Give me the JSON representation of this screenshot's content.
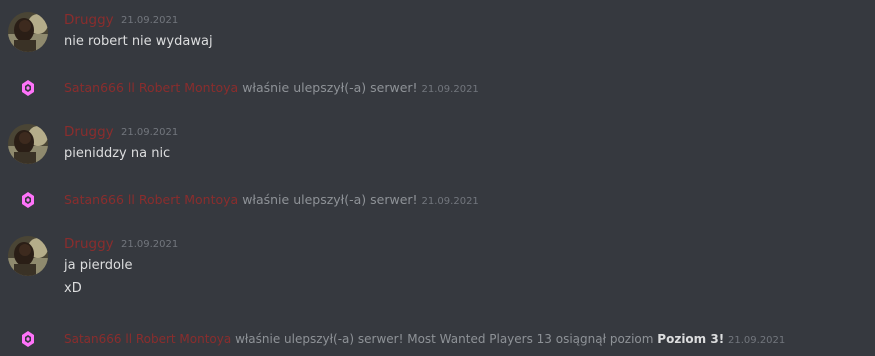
{
  "colors": {
    "background": "#36393f",
    "author_name": "#8a2d2d",
    "message_text": "#dcddde",
    "muted_text": "#8e9297",
    "timestamp": "#72767d",
    "boost_pink": "#ff73fa"
  },
  "messages": [
    {
      "author": "Druggy",
      "timestamp": "21.09.2021",
      "lines": [
        "nie robert nie wydawaj"
      ]
    },
    {
      "author": "Druggy",
      "timestamp": "21.09.2021",
      "lines": [
        "pieniddzy na nic"
      ]
    },
    {
      "author": "Druggy",
      "timestamp": "21.09.2021",
      "lines": [
        "ja pierdole",
        "xD"
      ]
    }
  ],
  "system_messages": [
    {
      "icon": "server-boost-icon",
      "author": "Satan666 ll Robert Montoya",
      "text": "właśnie ulepszył(-a) serwer!",
      "timestamp": "21.09.2021"
    },
    {
      "icon": "server-boost-icon",
      "author": "Satan666 ll Robert Montoya",
      "text": "właśnie ulepszył(-a) serwer!",
      "timestamp": "21.09.2021"
    },
    {
      "icon": "server-boost-icon",
      "author": "Satan666 ll Robert Montoya",
      "text": "właśnie ulepszył(-a) serwer! Most Wanted Players 13 osiągnął poziom",
      "bold": "Poziom 3!",
      "timestamp": "21.09.2021"
    }
  ]
}
